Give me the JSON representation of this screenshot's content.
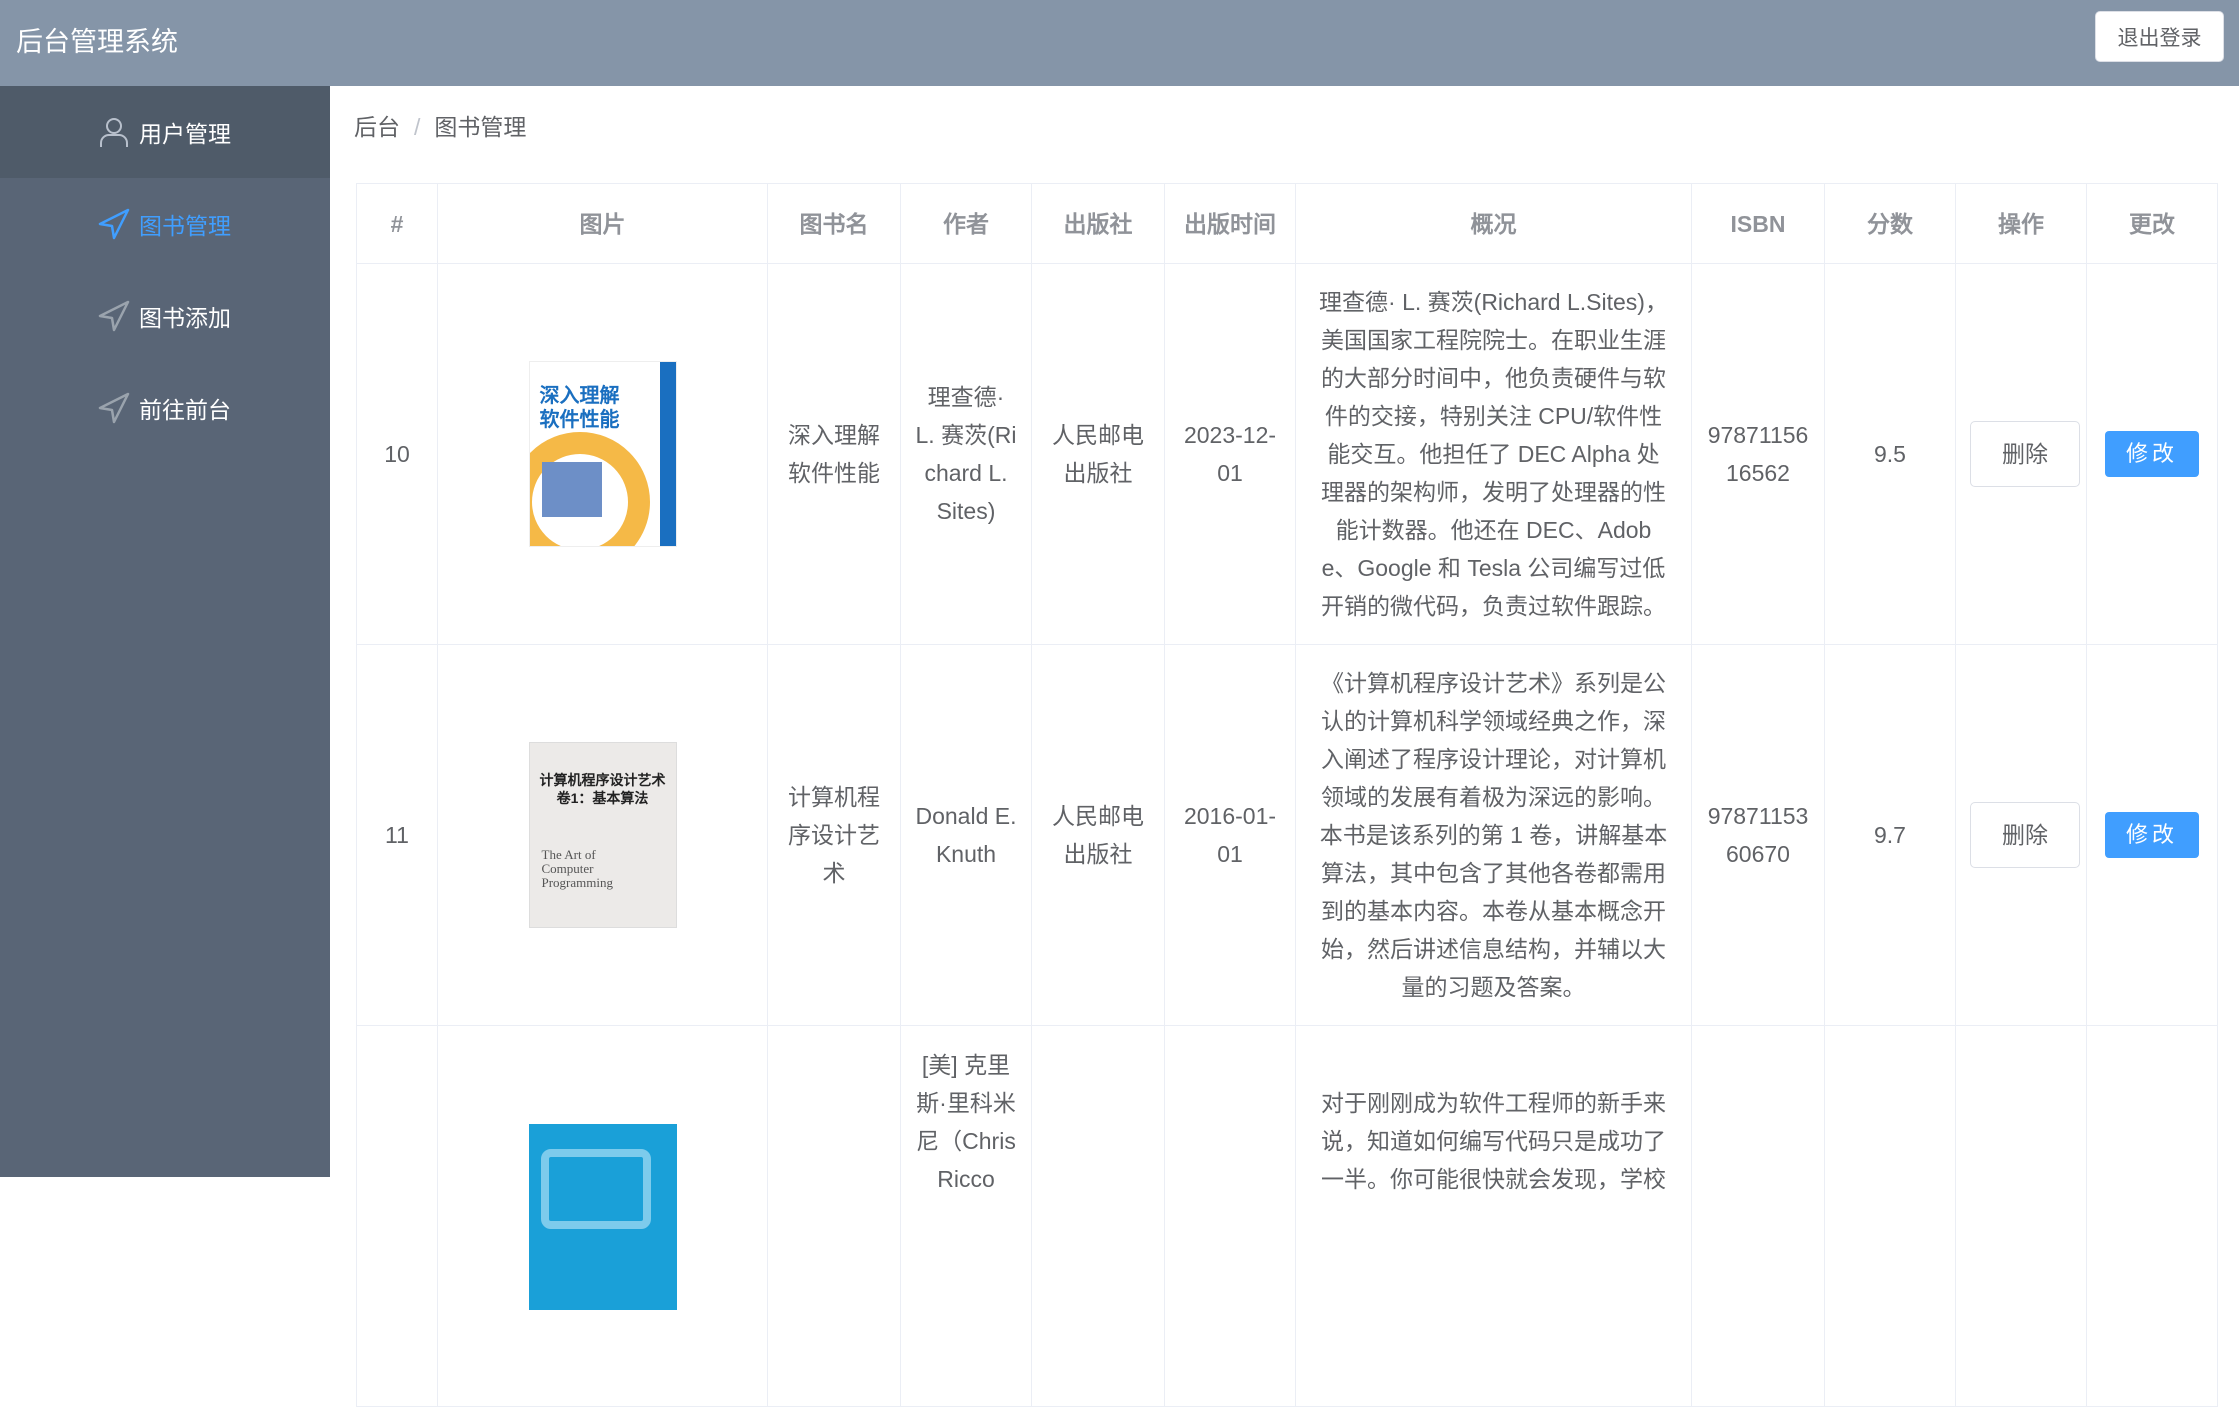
{
  "header": {
    "title": "后台管理系统",
    "logout_label": "退出登录"
  },
  "sidebar": {
    "items": [
      {
        "label": "用户管理",
        "icon": "user-icon"
      },
      {
        "label": "图书管理",
        "icon": "navigation-icon",
        "active": true
      },
      {
        "label": "图书添加",
        "icon": "navigation-icon"
      },
      {
        "label": "前往前台",
        "icon": "navigation-icon"
      }
    ]
  },
  "breadcrumb": {
    "items": [
      "后台",
      "图书管理"
    ],
    "separator": "/"
  },
  "table": {
    "columns": [
      "#",
      "图片",
      "图书名",
      "作者",
      "出版社",
      "出版时间",
      "概况",
      "ISBN",
      "分数",
      "操作",
      "更改"
    ],
    "delete_label": "删除",
    "modify_label": "修改",
    "rows": [
      {
        "id": "10",
        "cover_title": "深入理解\n软件性能",
        "name": "深入理解软件性能",
        "author": "理查德· L. 赛茨(Richard L. Sites)",
        "publisher": "人民邮电出版社",
        "date": "2023-12-01",
        "desc": "理查德· L. 赛茨(Richard L.Sites)，美国国家工程院院士。在职业生涯的大部分时间中，他负责硬件与软件的交接，特别关注 CPU/软件性能交互。他担任了 DEC Alpha 处理器的架构师，发明了处理器的性能计数器。他还在 DEC、Adobe、Google 和 Tesla 公司编写过低开销的微代码，负责过软件跟踪。",
        "isbn": "9787115616562",
        "score": "9.5"
      },
      {
        "id": "11",
        "cover_title": "计算机程序设计艺术\n卷1：基本算法",
        "name": "计算机程序设计艺术",
        "author": "Donald E. Knuth",
        "publisher": "人民邮电出版社",
        "date": "2016-01-01",
        "desc": "《计算机程序设计艺术》系列是公认的计算机科学领域经典之作，深入阐述了程序设计理论，对计算机领域的发展有着极为深远的影响。本书是该系列的第 1 卷，讲解基本算法，其中包含了其他各卷都需用到的基本内容。本卷从基本概念开始，然后讲述信息结构，并辅以大量的习题及答案。",
        "isbn": "9787115360670",
        "score": "9.7"
      },
      {
        "id": "",
        "cover_title": "",
        "name": "",
        "author": "[美] 克里斯·里科米尼（Chris Ricco",
        "publisher": "",
        "date": "",
        "desc": "对于刚刚成为软件工程师的新手来说，知道如何编写代码只是成功了一半。你可能很快就会发现，学校",
        "isbn": "",
        "score": ""
      }
    ]
  },
  "colors": {
    "header": "#8595a8",
    "sidebar": "#596576",
    "accent": "#409eff"
  }
}
